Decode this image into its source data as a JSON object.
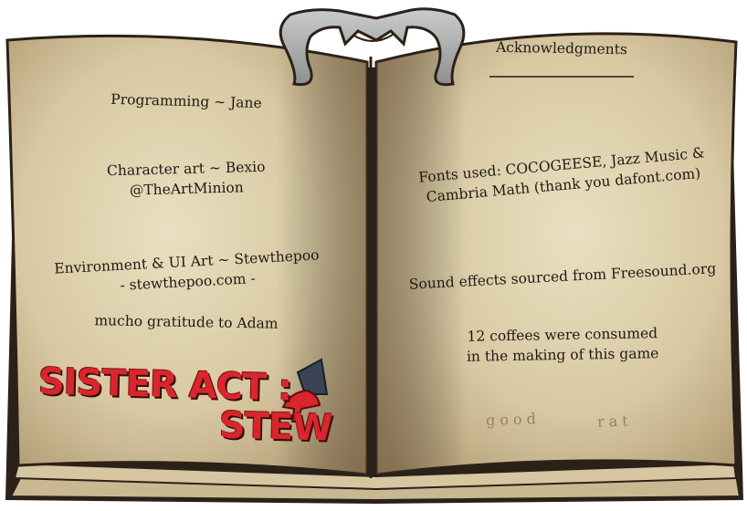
{
  "left_page": {
    "programming": "Programming ~ Jane",
    "character_art": "Character art ~ Bexio",
    "character_art_handle": "@TheArtMinion",
    "environment_art": "Environment & UI Art ~ Stewthepoo",
    "environment_art_site": "- stewthepoo.com -",
    "gratitude": "mucho gratitude to Adam"
  },
  "logo": {
    "line1": "SISTER ACT :",
    "line2": "STEW",
    "color": "#d8262c"
  },
  "right_page": {
    "title": "Acknowledgments",
    "fonts_line1": "Fonts used: COCOGEESE, Jazz Music &",
    "fonts_line2": "Cambria Math (thank you dafont.com)",
    "sound_effects": "Sound effects sourced from Freesound.org",
    "coffees_line1": "12 coffees were consumed",
    "coffees_line2": "in the making of this game",
    "signature_word1": "good",
    "signature_word2": "rat"
  },
  "colors": {
    "paper": "#d9cba6",
    "paper_dark": "#b4a079",
    "outline": "#2b2118",
    "bookmark": "#a7aaa9",
    "text": "#1e1a14"
  }
}
